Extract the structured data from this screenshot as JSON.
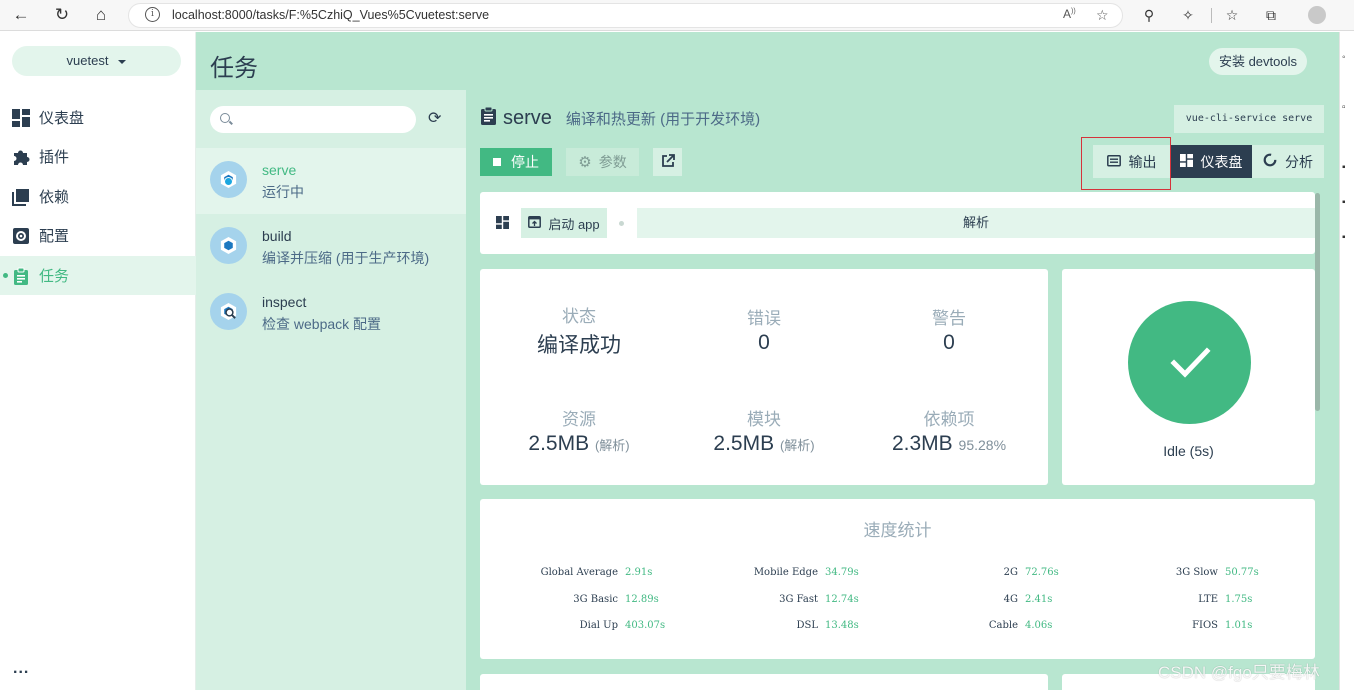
{
  "browser": {
    "url": "localhost:8000/tasks/F:%5CzhiQ_Vues%5Cvuetest:serve"
  },
  "sidebar": {
    "project_name": "vuetest",
    "items": [
      {
        "label": "仪表盘",
        "icon": "dashboard-icon"
      },
      {
        "label": "插件",
        "icon": "puzzle-icon"
      },
      {
        "label": "依赖",
        "icon": "library-icon"
      },
      {
        "label": "配置",
        "icon": "settings-icon"
      },
      {
        "label": "任务",
        "icon": "clipboard-icon",
        "active": true
      }
    ],
    "more": "..."
  },
  "header": {
    "title": "任务",
    "devtools_button": "安装 devtools"
  },
  "tasks": [
    {
      "name": "serve",
      "description": "运行中",
      "active": true,
      "running": true
    },
    {
      "name": "build",
      "description": "编译并压缩 (用于生产环境)"
    },
    {
      "name": "inspect",
      "description": "检查 webpack 配置"
    }
  ],
  "task_detail": {
    "name": "serve",
    "description": "编译和热更新 (用于开发环境)",
    "command": "vue-cli-service serve",
    "stop_button": "停止",
    "params_button": "参数",
    "views": {
      "output": "输出",
      "dashboard": "仪表盘",
      "analyze": "分析"
    },
    "launch_app": "启动 app",
    "analyze_tab": "解析"
  },
  "stats": {
    "status_label": "状态",
    "status_value": "编译成功",
    "errors_label": "错误",
    "errors_value": "0",
    "warnings_label": "警告",
    "warnings_value": "0",
    "assets_label": "资源",
    "assets_value": "2.5MB",
    "assets_sub": "(解析)",
    "modules_label": "模块",
    "modules_value": "2.5MB",
    "modules_sub": "(解析)",
    "deps_label": "依赖项",
    "deps_value": "2.3MB",
    "deps_percent": "95.28%"
  },
  "build_status": {
    "text": "Idle (5s)",
    "color": "#42b983"
  },
  "speed": {
    "title": "速度统计",
    "rows": [
      [
        {
          "label": "Global Average",
          "value": "2.91s"
        },
        {
          "label": "Mobile Edge",
          "value": "34.79s"
        },
        {
          "label": "2G",
          "value": "72.76s"
        },
        {
          "label": "3G Slow",
          "value": "50.77s"
        }
      ],
      [
        {
          "label": "3G Basic",
          "value": "12.89s"
        },
        {
          "label": "3G Fast",
          "value": "12.74s"
        },
        {
          "label": "4G",
          "value": "2.41s"
        },
        {
          "label": "LTE",
          "value": "1.75s"
        }
      ],
      [
        {
          "label": "Dial Up",
          "value": "403.07s"
        },
        {
          "label": "DSL",
          "value": "13.48s"
        },
        {
          "label": "Cable",
          "value": "4.06s"
        },
        {
          "label": "FIOS",
          "value": "1.01s"
        }
      ]
    ]
  },
  "watermark": "CSDN @fgo只要梅林",
  "colors": {
    "accent": "#42b983",
    "dark": "#2c3e50",
    "panel": "#b8e6d0",
    "highlight_box": "#d5333b"
  }
}
